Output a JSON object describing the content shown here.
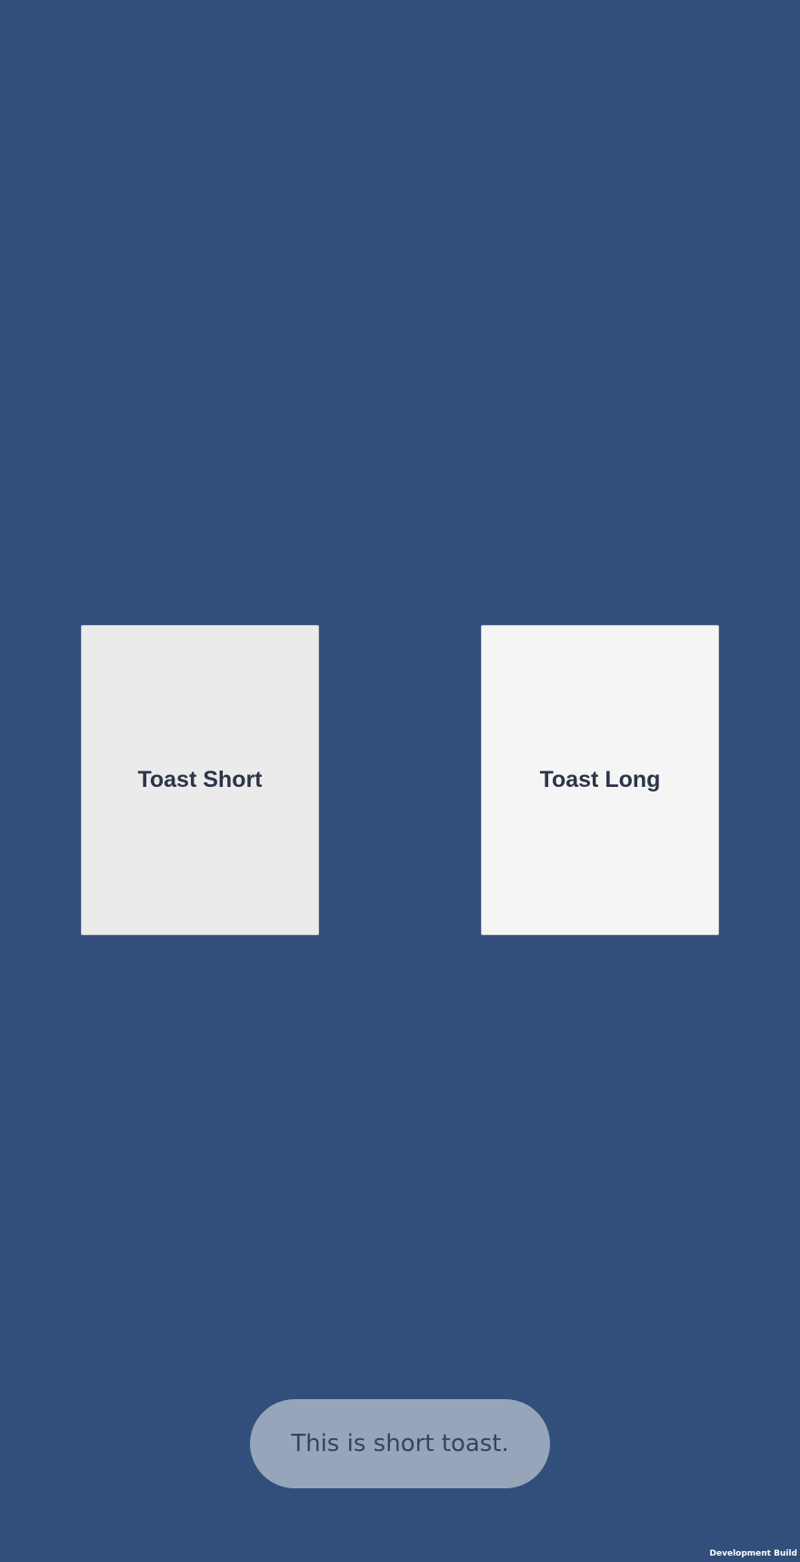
{
  "colors": {
    "background": "#324f7b",
    "button_short_bg": "#ebebeb",
    "button_long_bg": "#f5f5f5",
    "button_text": "#2c3548",
    "toast_bg": "#97a5ba",
    "toast_text": "#3a4255"
  },
  "buttons": {
    "toast_short_label": "Toast Short",
    "toast_long_label": "Toast Long"
  },
  "toast": {
    "message": "This is short toast."
  },
  "watermark": {
    "label": "Development Build"
  }
}
